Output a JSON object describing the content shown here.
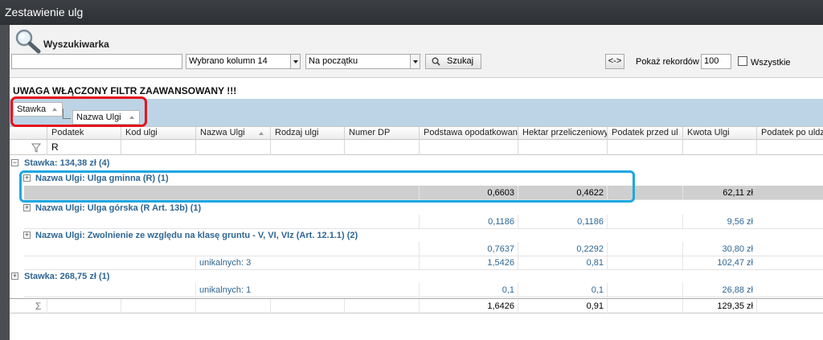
{
  "window": {
    "title": "Zestawienie ulg"
  },
  "search": {
    "title": "Wyszukiwarka",
    "query_value": "",
    "columns_select": "Wybrano kolumn 14",
    "match_select": "Na początku",
    "search_button": "Szukaj",
    "swap_button": "<->",
    "records_label": "Pokaż rekordów",
    "records_value": "100",
    "all_label": "Wszystkie"
  },
  "filter_warning": "UWAGA WŁĄCZONY FILTR ZAAWANSOWANY !!!",
  "grouping": {
    "chip1": "Stawka",
    "chip2": "Nazwa Ulgi"
  },
  "columns": [
    "Podatek",
    "Kod ulgi",
    "Nazwa Ulgi",
    "Rodzaj ulgi",
    "Numer DP",
    "Podstawa opodatkowania",
    "Hektar przeliczeniowy",
    "Podatek przed ul",
    "Kwota Ulgi",
    "Podatek po uldze"
  ],
  "filter_row": {
    "podatek": "R"
  },
  "groups": {
    "stawka1": "Stawka:  134,38 zł  (4)",
    "ulga1": "Nazwa Ulgi:  Ulga gminna (R)  (1)",
    "ulga2": "Nazwa Ulgi:  Ulga górska (R Art. 13b)  (1)",
    "ulga3": "Nazwa Ulgi:  Zwolnienie ze względu na klasę gruntu - V, VI, VIz (Art. 12.1.1)  (2)",
    "stawka2": "Stawka:  268,75 zł  (1)"
  },
  "rows": {
    "r1": {
      "podstawa": "0,6603",
      "hektar": "0,4622",
      "kwota": "62,11 zł"
    },
    "r2": {
      "podstawa": "0,1186",
      "hektar": "0,1186",
      "kwota": "9,56 zł"
    },
    "r3": {
      "podstawa": "0,7637",
      "hektar": "0,2292",
      "kwota": "30,80 zł"
    },
    "s1": {
      "label": "unikalnych: 3",
      "podstawa": "1,5426",
      "hektar": "0,81",
      "kwota": "102,47 zł"
    },
    "s2": {
      "label": "unikalnych: 1",
      "podstawa": "0,1",
      "hektar": "0,1",
      "kwota": "26,88 zł"
    }
  },
  "totals": {
    "sigma": "Σ",
    "podstawa": "1,6426",
    "hektar": "0,91",
    "kwota": "129,35 zł"
  },
  "colors": {
    "title_bar": "#2f3236",
    "group_area": "#bcd4e6",
    "group_text": "#2e6694",
    "highlight_red": "#e4141c",
    "highlight_blue": "#1ea7e1",
    "selected_row": "#cfcfcf"
  }
}
